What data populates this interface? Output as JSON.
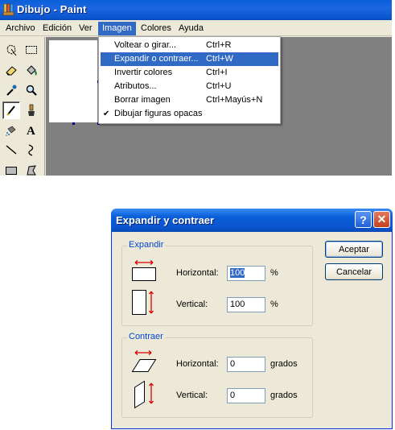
{
  "window": {
    "title": "Dibujo - Paint"
  },
  "menubar": [
    {
      "label": "Archivo"
    },
    {
      "label": "Edición"
    },
    {
      "label": "Ver"
    },
    {
      "label": "Imagen",
      "active": true
    },
    {
      "label": "Colores"
    },
    {
      "label": "Ayuda"
    }
  ],
  "image_menu": [
    {
      "label": "Voltear o girar...",
      "shortcut": "Ctrl+R",
      "highlighted": false,
      "checked": false
    },
    {
      "label": "Expandir o contraer...",
      "shortcut": "Ctrl+W",
      "highlighted": true,
      "checked": false
    },
    {
      "label": "Invertir colores",
      "shortcut": "Ctrl+I",
      "highlighted": false,
      "checked": false
    },
    {
      "label": "Atributos...",
      "shortcut": "Ctrl+U",
      "highlighted": false,
      "checked": false
    },
    {
      "label": "Borrar imagen",
      "shortcut": "Ctrl+Mayús+N",
      "highlighted": false,
      "checked": false
    },
    {
      "label": "Dibujar figuras opacas",
      "shortcut": "",
      "highlighted": false,
      "checked": true
    }
  ],
  "toolbox": [
    "free-select-icon",
    "rect-select-icon",
    "eraser-icon",
    "fill-bucket-icon",
    "eyedropper-icon",
    "magnifier-icon",
    "pencil-icon",
    "brush-icon",
    "airbrush-icon",
    "text-icon",
    "line-icon",
    "curve-icon",
    "rectangle-icon",
    "polygon-icon"
  ],
  "dialog": {
    "title": "Expandir y contraer",
    "help_button": "?",
    "close_button": "✕",
    "expand": {
      "group_label": "Expandir",
      "horizontal_label": "Horizontal:",
      "horizontal_value": "100",
      "horizontal_unit": "%",
      "vertical_label": "Vertical:",
      "vertical_value": "100",
      "vertical_unit": "%"
    },
    "skew": {
      "group_label": "Contraer",
      "horizontal_label": "Horizontal:",
      "horizontal_value": "0",
      "horizontal_unit": "grados",
      "vertical_label": "Vertical:",
      "vertical_value": "0",
      "vertical_unit": "grados"
    },
    "ok_label": "Aceptar",
    "cancel_label": "Cancelar"
  },
  "colors": {
    "titlebar": "#0b55cf",
    "menu_highlight": "#316ac5",
    "workspace": "#808080",
    "group_label": "#0046d5"
  }
}
